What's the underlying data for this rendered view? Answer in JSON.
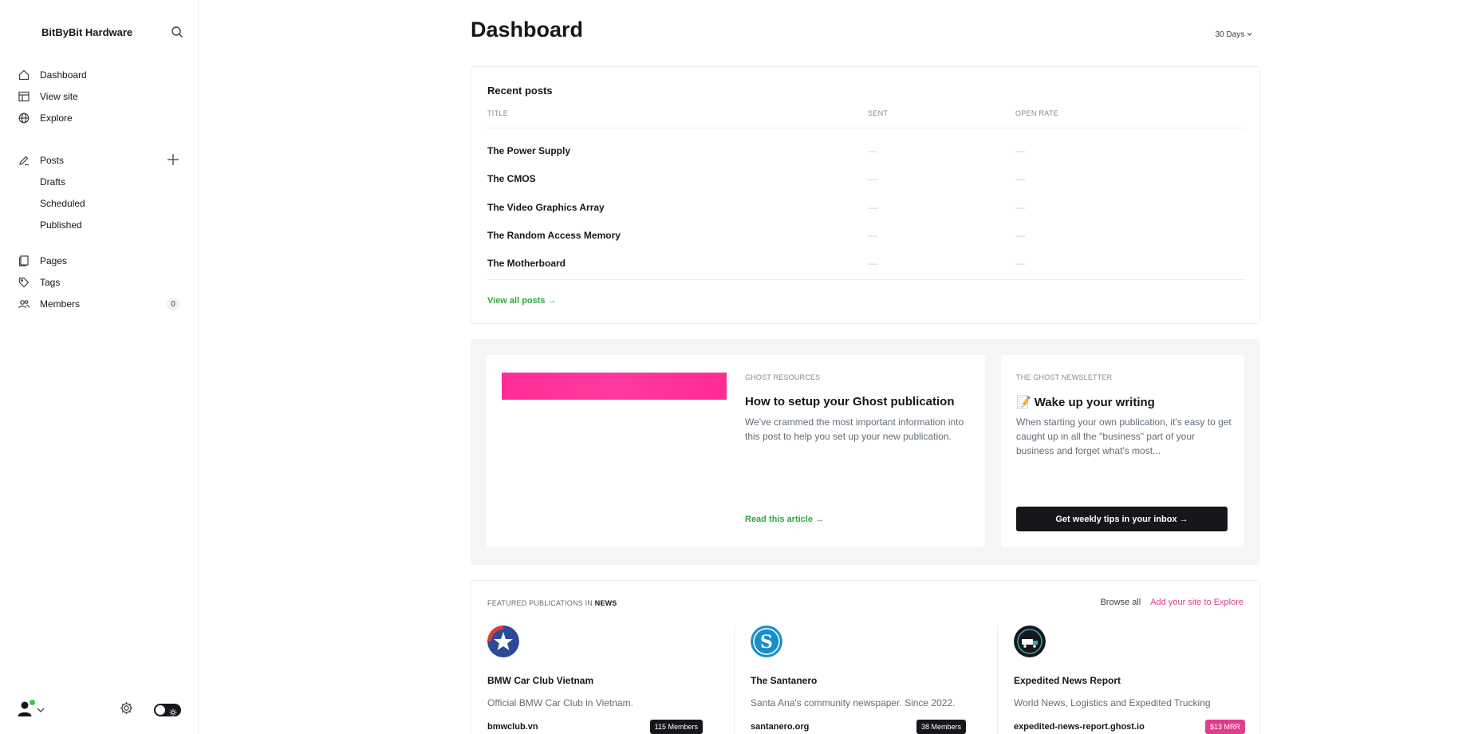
{
  "sidebar": {
    "site_title": "BitByBit Hardware",
    "nav": {
      "dashboard": "Dashboard",
      "view_site": "View site",
      "explore": "Explore",
      "posts": "Posts",
      "drafts": "Drafts",
      "scheduled": "Scheduled",
      "published": "Published",
      "pages": "Pages",
      "tags": "Tags",
      "members": "Members",
      "members_count": "0"
    }
  },
  "header": {
    "title": "Dashboard",
    "range": "30 Days"
  },
  "recent_posts": {
    "heading": "Recent posts",
    "columns": {
      "title": "TITLE",
      "sent": "SENT",
      "open_rate": "OPEN RATE"
    },
    "rows": [
      {
        "title": "The Power Supply",
        "sent": "—",
        "open_rate": "—"
      },
      {
        "title": "The CMOS",
        "sent": "—",
        "open_rate": "—"
      },
      {
        "title": "The Video Graphics Array",
        "sent": "—",
        "open_rate": "—"
      },
      {
        "title": "The Random Access Memory",
        "sent": "—",
        "open_rate": "—"
      },
      {
        "title": "The Motherboard",
        "sent": "—",
        "open_rate": "—"
      }
    ],
    "view_all": "View all posts →"
  },
  "resources": {
    "category": "GHOST RESOURCES",
    "title": "How to setup your Ghost publication",
    "excerpt": "We've crammed the most important information into this post to help you set up your new publication.",
    "link": "Read this article →",
    "image_color": "#ff2d97"
  },
  "newsletter": {
    "category": "THE GHOST NEWSLETTER",
    "emoji": "📝",
    "title": "Wake up your writing",
    "excerpt": "When starting your own publication, it's easy to get caught up in all the \"business\" part of your business and forget what's most...",
    "button": "Get weekly tips in your inbox →"
  },
  "featured": {
    "heading_prefix": "FEATURED PUBLICATIONS IN",
    "heading_topic": "NEWS",
    "browse_all": "Browse all",
    "add_site": "Add your site to Explore",
    "publications": [
      {
        "name": "BMW Car Club Vietnam",
        "description": "Official BMW Car Club in Vietnam.",
        "domain": "bmwclub.vn",
        "badge": "115 Members",
        "badge_color": "#15171a",
        "logo_icon": "star-logo-icon"
      },
      {
        "name": "The Santanero",
        "description": "Santa Ana's community newspaper. Since 2022.",
        "domain": "santanero.org",
        "badge": "38 Members",
        "badge_color": "#15171a",
        "logo_icon": "s-letter-logo-icon"
      },
      {
        "name": "Expedited News Report",
        "description": "World News, Logistics and Expedited Trucking",
        "domain": "expedited-news-report.ghost.io",
        "badge": "$13 MRR",
        "badge_color": "#e23c8c",
        "logo_icon": "truck-logo-icon"
      }
    ]
  },
  "colors": {
    "accent_green": "#2fa839",
    "accent_pink": "#e23c8c",
    "dark": "#15171a"
  }
}
